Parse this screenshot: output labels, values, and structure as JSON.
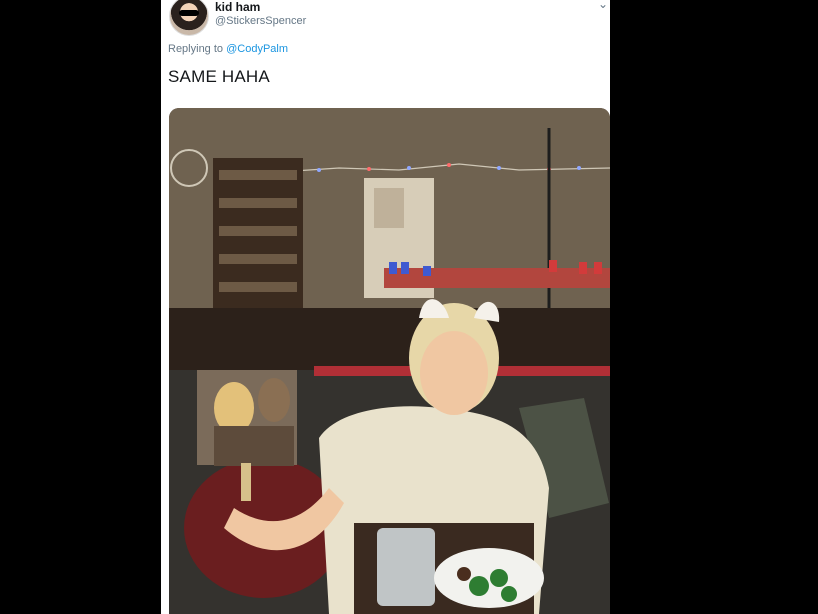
{
  "tweet": {
    "author_name": "kid ham",
    "author_handle": "@StickersSpencer",
    "replying_prefix": "Replying to",
    "replying_to": "@CodyPalm",
    "text": "SAME HAHA"
  },
  "icons": {
    "avatar": "avatar-image",
    "more": "chevron-down-icon"
  },
  "media": {
    "description_icon": "photo"
  },
  "colors": {
    "background": "#000000",
    "card": "#ffffff",
    "link": "#1b95e0",
    "muted": "#657786",
    "text": "#14171a"
  }
}
